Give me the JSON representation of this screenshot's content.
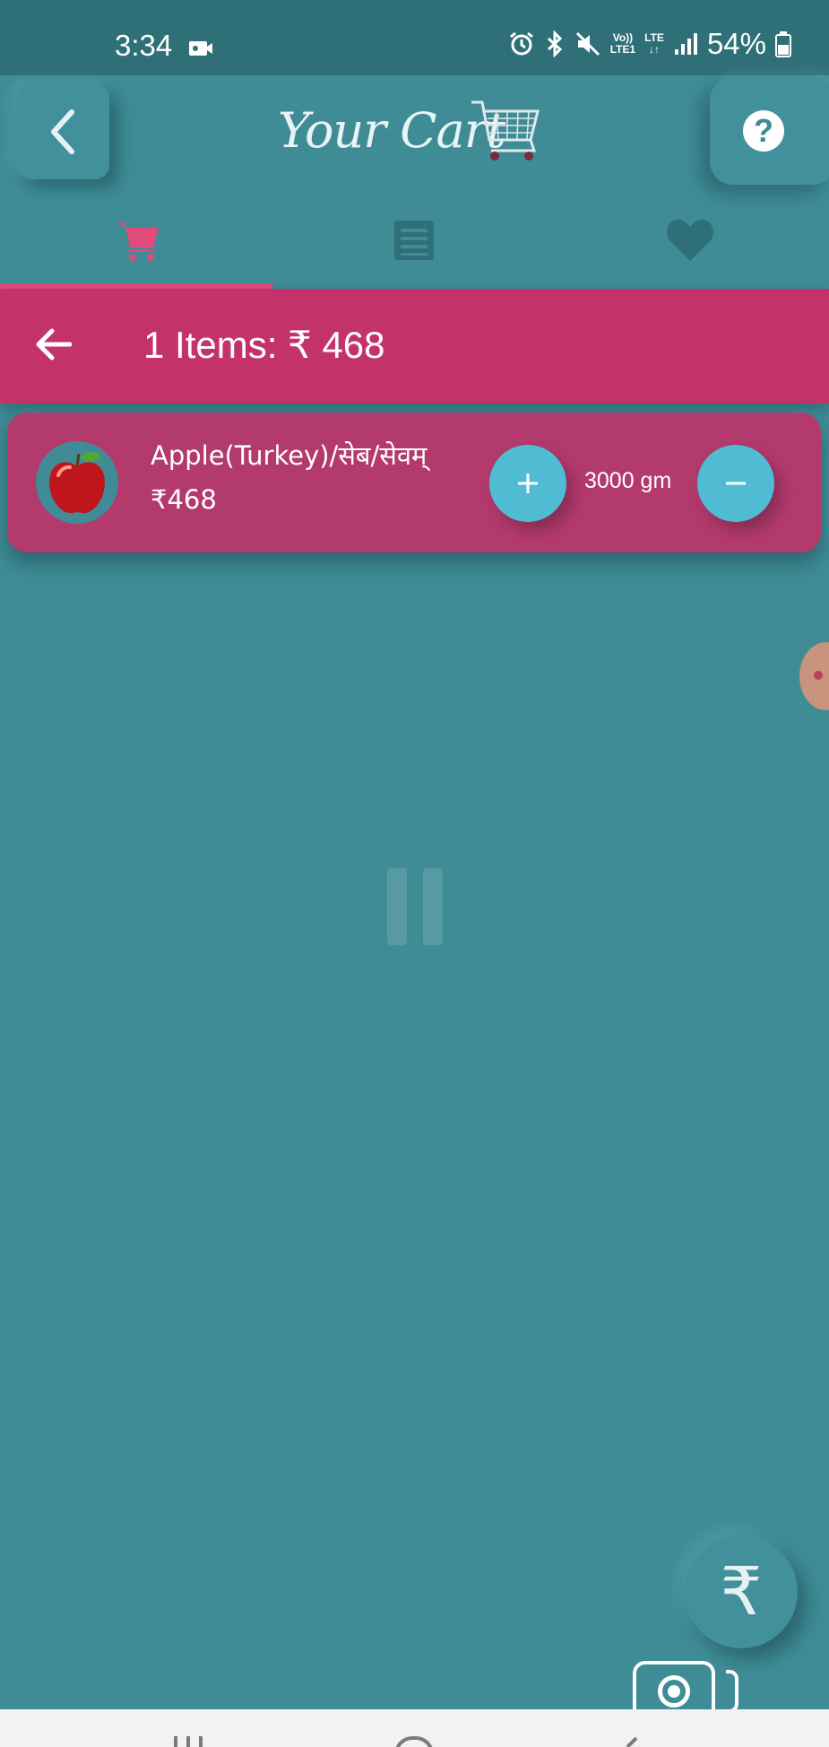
{
  "status_bar": {
    "time": "3:34",
    "network_label_top": "Vo))",
    "network_label_bottom": "LTE1",
    "lte_label": "LTE",
    "battery": "54%",
    "icons": [
      "video-icon",
      "alarm-icon",
      "bluetooth-icon",
      "mute-icon",
      "signal-icon",
      "battery-icon"
    ]
  },
  "header": {
    "title": "Your Cart",
    "back_icon": "chevron-left-icon",
    "help_label": "?",
    "cart_icon": "shopping-cart-icon"
  },
  "tabs": [
    {
      "name": "cart",
      "icon": "cart-icon",
      "active": true
    },
    {
      "name": "list",
      "icon": "list-icon",
      "active": false
    },
    {
      "name": "favorites",
      "icon": "heart-icon",
      "active": false
    }
  ],
  "summary": {
    "text": "1 Items: ₹ 468"
  },
  "items": [
    {
      "name": "Apple(Turkey)/सेब/सेवम्",
      "price": "₹468",
      "quantity": "3000 gm",
      "plus_label": "+",
      "minus_label": "−"
    }
  ],
  "fab": {
    "label": "₹"
  },
  "colors": {
    "background": "#3f8c97",
    "status_bar": "#2f6f77",
    "accent_pink": "#c3336a",
    "card_pink": "#b33a6d",
    "qty_button": "#4fbcd4",
    "active_tab": "#e14b7c",
    "inactive_tab": "#2f6f77"
  }
}
